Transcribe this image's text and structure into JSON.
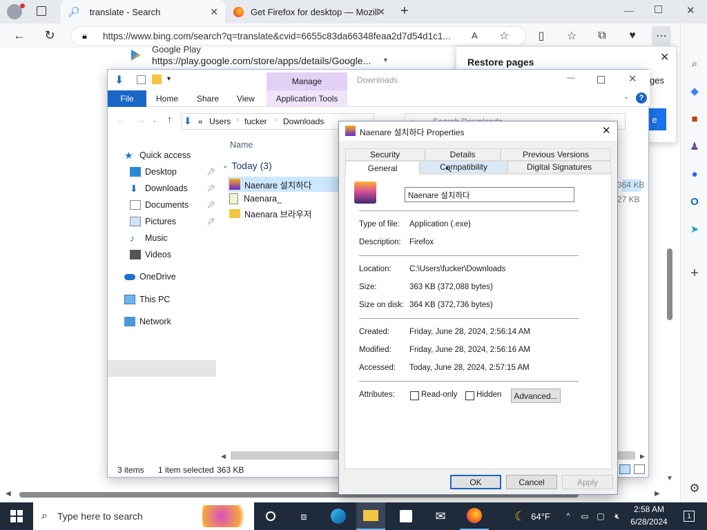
{
  "browser": {
    "tabs": [
      {
        "label": "translate - Search"
      },
      {
        "label": "Get Firefox for desktop — Mozill"
      }
    ],
    "url": "https://www.bing.com/search?q=translate&cvid=6655c83da66348feaa2d7d54d1c1...",
    "suggestion_title": "Google Play",
    "suggestion_url": "https://play.google.com/store/apps/details/Google...",
    "restore_title": "Restore pages",
    "restore_partial": "ges",
    "restore_btn_partial": "e"
  },
  "explorer": {
    "ribbon_tabs": [
      "File",
      "Home",
      "Share",
      "View",
      "Application Tools"
    ],
    "manage_label": "Manage",
    "context_title": "Downloads",
    "breadcrumb": [
      "«",
      "Users",
      "fucker",
      "Downloads"
    ],
    "search_placeholder": "Search Downloads",
    "nav": {
      "quick_access": "Quick access",
      "items": [
        "Desktop",
        "Downloads",
        "Documents",
        "Pictures",
        "Music",
        "Videos"
      ],
      "onedrive": "OneDrive",
      "thispc": "This PC",
      "network": "Network"
    },
    "column_name": "Name",
    "group_label": "Today (3)",
    "files": [
      "Naenare 설치하다",
      "Naenara_",
      "Naenara 브라우저"
    ],
    "sizes": [
      "364 KB",
      "27 KB"
    ],
    "status": {
      "items": "3 items",
      "selected": "1 item selected",
      "size": "363 KB"
    }
  },
  "props": {
    "title": "Naenare 설치하다 Properties",
    "tabs_row1": [
      "Security",
      "Details",
      "Previous Versions"
    ],
    "tabs_row2": [
      "General",
      "Compatibility",
      "Digital Signatures"
    ],
    "filename": "Naenare 설치하다",
    "type_label": "Type of file:",
    "type_value": "Application (.exe)",
    "desc_label": "Description:",
    "desc_value": "Firefox",
    "loc_label": "Location:",
    "loc_value": "C:\\Users\\fucker\\Downloads",
    "size_label": "Size:",
    "size_value": "363 KB (372,088 bytes)",
    "sod_label": "Size on disk:",
    "sod_value": "364 KB (372,736 bytes)",
    "created_label": "Created:",
    "created_value": "Friday, June 28, 2024, 2:56:14 AM",
    "modified_label": "Modified:",
    "modified_value": "Friday, June 28, 2024, 2:56:16 AM",
    "accessed_label": "Accessed:",
    "accessed_value": "Today, June 28, 2024, 2:57:15 AM",
    "attr_label": "Attributes:",
    "readonly": "Read-only",
    "hidden": "Hidden",
    "advanced": "Advanced...",
    "ok": "OK",
    "cancel": "Cancel",
    "apply": "Apply"
  },
  "taskbar": {
    "search_placeholder": "Type here to search",
    "weather": "64°F",
    "time": "2:58 AM",
    "date": "6/28/2024",
    "notif_count": "1"
  }
}
